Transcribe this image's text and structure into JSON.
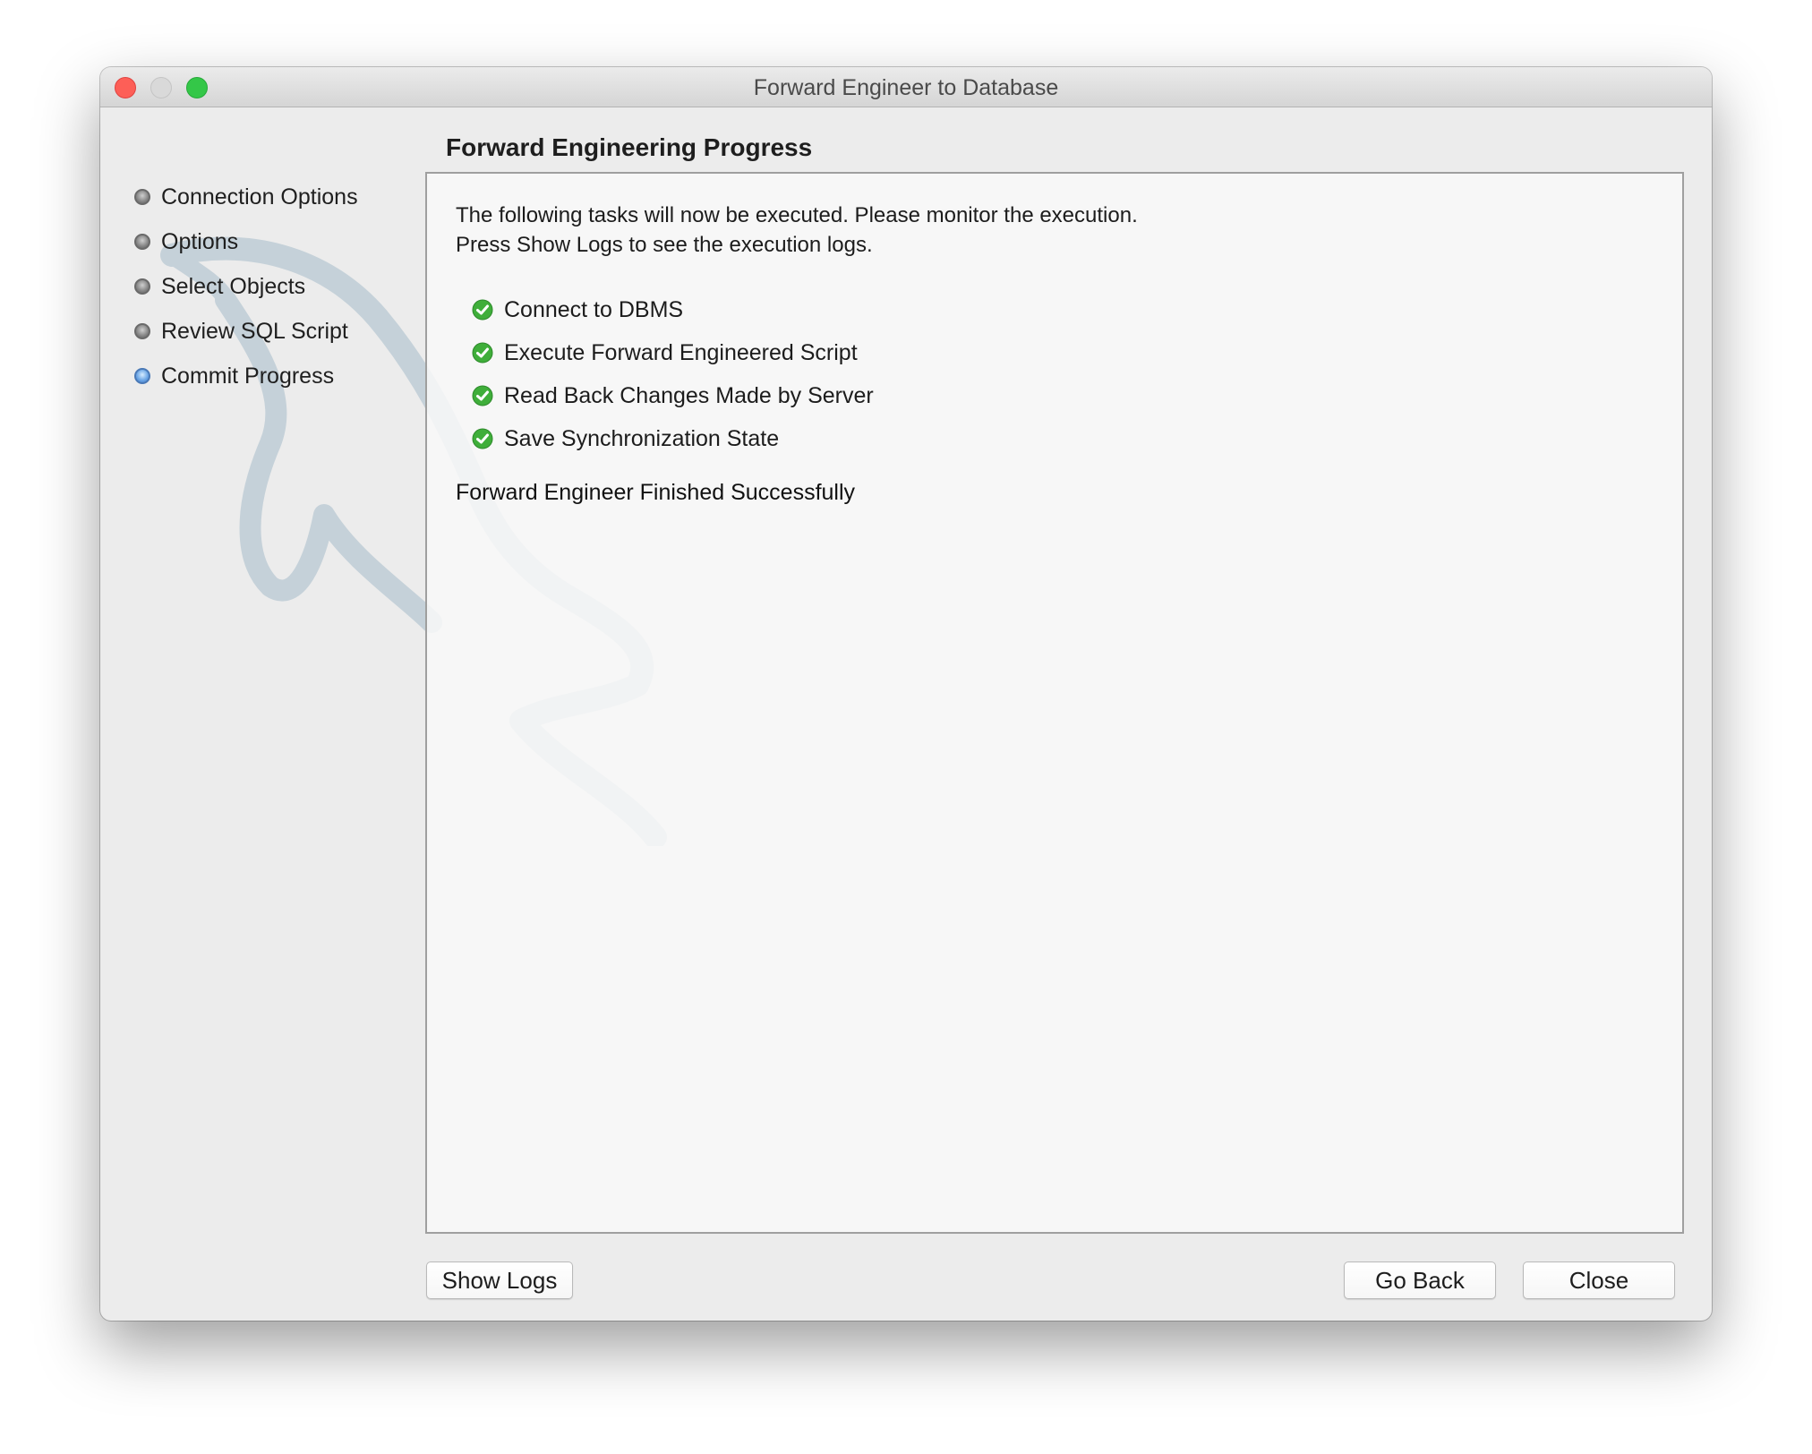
{
  "window": {
    "title": "Forward Engineer to Database"
  },
  "sidebar": {
    "steps": [
      {
        "label": "Connection Options",
        "state": "done"
      },
      {
        "label": "Options",
        "state": "done"
      },
      {
        "label": "Select Objects",
        "state": "done"
      },
      {
        "label": "Review SQL Script",
        "state": "done"
      },
      {
        "label": "Commit Progress",
        "state": "active"
      }
    ]
  },
  "main": {
    "title": "Forward Engineering Progress",
    "intro_line1": "The following tasks will now be executed. Please monitor the execution.",
    "intro_line2": "Press Show Logs to see the execution logs.",
    "tasks": [
      {
        "label": "Connect to DBMS",
        "status": "completed",
        "icon": "check-icon"
      },
      {
        "label": "Execute Forward Engineered Script",
        "status": "completed",
        "icon": "check-icon"
      },
      {
        "label": "Read Back Changes Made by Server",
        "status": "completed",
        "icon": "check-icon"
      },
      {
        "label": "Save Synchronization State",
        "status": "completed",
        "icon": "check-icon"
      }
    ],
    "finish_message": "Forward Engineer Finished Successfully"
  },
  "footer": {
    "show_logs_label": "Show Logs",
    "go_back_label": "Go Back",
    "close_label": "Close"
  },
  "colors": {
    "success_green": "#3fae3a",
    "active_step_blue": "#4a86d6",
    "close_light": "#fd5f57",
    "zoom_light": "#34c748"
  }
}
